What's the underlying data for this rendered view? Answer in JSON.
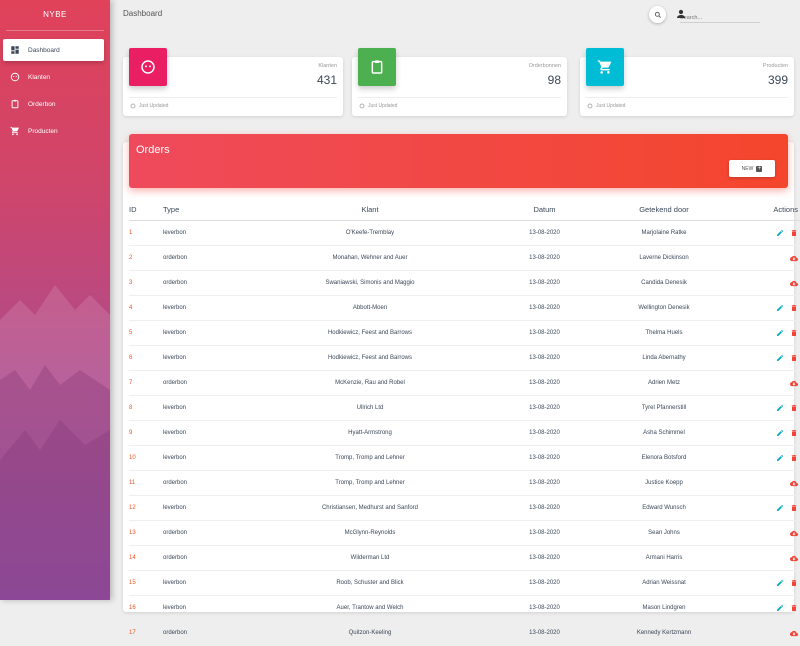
{
  "brand": "NYBE",
  "nav": [
    {
      "label": "Dashboard",
      "icon": "dashboard-icon",
      "active": true
    },
    {
      "label": "Klanten",
      "icon": "face-icon",
      "active": false
    },
    {
      "label": "Orderbon",
      "icon": "clipboard-icon",
      "active": false
    },
    {
      "label": "Producten",
      "icon": "cart-icon",
      "active": false
    }
  ],
  "header": {
    "title": "Dashboard",
    "search_placeholder": "Search..."
  },
  "stats": [
    {
      "label": "Klanten",
      "value": "431",
      "footer": "Just Updated",
      "color": "#e91e63",
      "icon": "face-icon"
    },
    {
      "label": "Orderbonnen",
      "value": "98",
      "footer": "Just Updated",
      "color": "#4caf50",
      "icon": "clipboard-icon"
    },
    {
      "label": "Producten",
      "value": "399",
      "footer": "Just Updated",
      "color": "#00bcd4",
      "icon": "cart-icon"
    }
  ],
  "orders": {
    "title": "Orders",
    "new_label": "NEW",
    "columns": [
      "ID",
      "Type",
      "Klant",
      "Datum",
      "Getekend door",
      "Actions"
    ],
    "rows": [
      {
        "id": "1",
        "type": "leverbon",
        "klant": "O'Keefe-Tremblay",
        "datum": "13-08-2020",
        "door": "Marjolaine Ratke"
      },
      {
        "id": "2",
        "type": "orderbon",
        "klant": "Monahan, Wehner and Auer",
        "datum": "13-08-2020",
        "door": "Laverne Dickinson"
      },
      {
        "id": "3",
        "type": "orderbon",
        "klant": "Swaniawski, Simonis and Maggio",
        "datum": "13-08-2020",
        "door": "Candida Denesik"
      },
      {
        "id": "4",
        "type": "leverbon",
        "klant": "Abbott-Moen",
        "datum": "13-08-2020",
        "door": "Wellington Denesik"
      },
      {
        "id": "5",
        "type": "leverbon",
        "klant": "Hodkiewicz, Feest and Barrows",
        "datum": "13-08-2020",
        "door": "Thelma Huels"
      },
      {
        "id": "6",
        "type": "leverbon",
        "klant": "Hodkiewicz, Feest and Barrows",
        "datum": "13-08-2020",
        "door": "Linda Abernathy"
      },
      {
        "id": "7",
        "type": "orderbon",
        "klant": "McKenzie, Rau and Robel",
        "datum": "13-08-2020",
        "door": "Adrien Metz"
      },
      {
        "id": "8",
        "type": "leverbon",
        "klant": "Ullrich Ltd",
        "datum": "13-08-2020",
        "door": "Tyrel Pfannerstill"
      },
      {
        "id": "9",
        "type": "leverbon",
        "klant": "Hyatt-Armstrong",
        "datum": "13-08-2020",
        "door": "Asha Schimmel"
      },
      {
        "id": "10",
        "type": "leverbon",
        "klant": "Tromp, Tromp and Lehner",
        "datum": "13-08-2020",
        "door": "Elenora Botsford"
      },
      {
        "id": "11",
        "type": "orderbon",
        "klant": "Tromp, Tromp and Lehner",
        "datum": "13-08-2020",
        "door": "Justice Koepp"
      },
      {
        "id": "12",
        "type": "leverbon",
        "klant": "Christiansen, Medhurst and Sanford",
        "datum": "13-08-2020",
        "door": "Edward Wunsch"
      },
      {
        "id": "13",
        "type": "orderbon",
        "klant": "McGlynn-Reynolds",
        "datum": "13-08-2020",
        "door": "Sean Johns"
      },
      {
        "id": "14",
        "type": "orderbon",
        "klant": "Wilderman Ltd",
        "datum": "13-08-2020",
        "door": "Armani Harris"
      },
      {
        "id": "15",
        "type": "leverbon",
        "klant": "Roob, Schuster and Blick",
        "datum": "13-08-2020",
        "door": "Adrian Weissnat"
      },
      {
        "id": "16",
        "type": "leverbon",
        "klant": "Auer, Trantow and Welch",
        "datum": "13-08-2020",
        "door": "Mason Lindgren"
      },
      {
        "id": "17",
        "type": "orderbon",
        "klant": "Quitzon-Keeling",
        "datum": "13-08-2020",
        "door": "Kennedy Kertzmann"
      }
    ]
  },
  "colors": {
    "accent_orange": "#f4511e",
    "edit_blue": "#00acc1",
    "delete_red": "#f44336"
  }
}
